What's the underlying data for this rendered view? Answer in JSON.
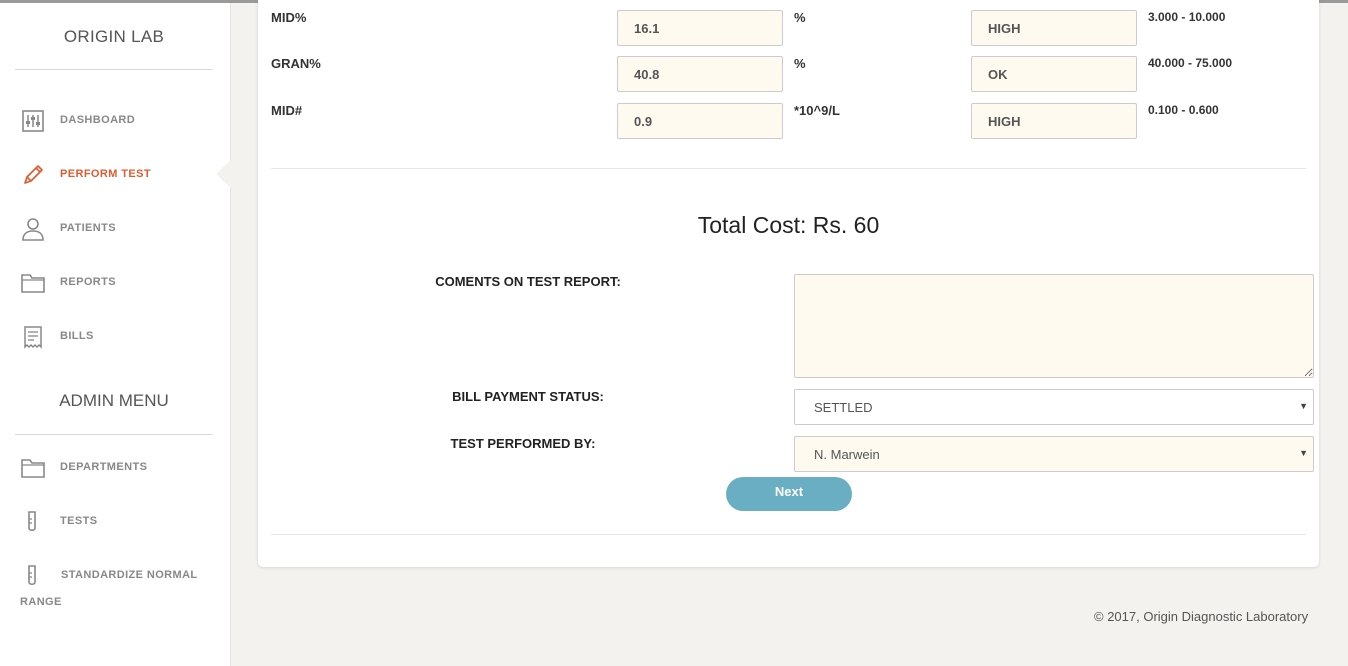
{
  "sidebar": {
    "brand": "ORIGIN LAB",
    "items": [
      {
        "label": "DASHBOARD",
        "icon": "sliders-icon"
      },
      {
        "label": "PERFORM TEST",
        "icon": "pencil-icon",
        "active": true
      },
      {
        "label": "PATIENTS",
        "icon": "user-icon"
      },
      {
        "label": "REPORTS",
        "icon": "folder-icon"
      },
      {
        "label": "BILLS",
        "icon": "receipt-icon"
      }
    ],
    "admin_title": "ADMIN MENU",
    "admin_items": [
      {
        "label": "DEPARTMENTS",
        "icon": "folder-icon"
      },
      {
        "label": "TESTS",
        "icon": "test-tube-icon"
      },
      {
        "label": "STANDARDIZE NORMAL",
        "label_wrap": "RANGE",
        "icon": "test-tube-icon"
      }
    ]
  },
  "results": [
    {
      "name": "MID%",
      "value": "16.1",
      "unit": "%",
      "status": "HIGH",
      "range": "3.000 - 10.000"
    },
    {
      "name": "GRAN%",
      "value": "40.8",
      "unit": "%",
      "status": "OK",
      "range": "40.000 - 75.000"
    },
    {
      "name": "MID#",
      "value": "0.9",
      "unit": "*10^9/L",
      "status": "HIGH",
      "range": "0.100 - 0.600"
    }
  ],
  "total_cost": "Total Cost: Rs. 60",
  "form": {
    "comments_label": "COMENTS ON TEST REPORT:",
    "comments_value": "",
    "payment_label": "BILL PAYMENT STATUS:",
    "payment_value": "SETTLED",
    "performed_label": "TEST PERFORMED BY:",
    "performed_value": "N. Marwein",
    "next_label": "Next"
  },
  "footer": "© 2017, Origin Diagnostic Laboratory",
  "colors": {
    "accent": "#de5c32",
    "button": "#6aaec3",
    "field_bg": "#fffaf0",
    "page_bg": "#f3f2ee"
  }
}
